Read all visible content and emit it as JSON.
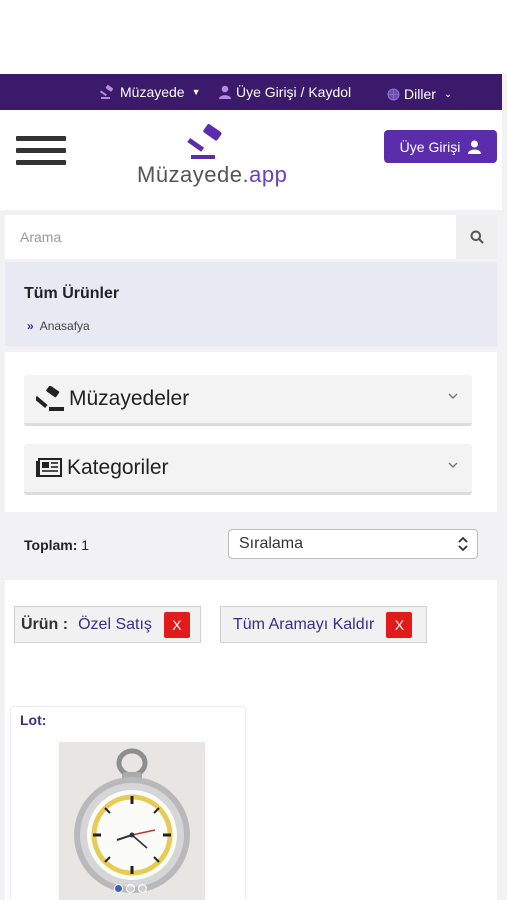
{
  "topbar": {
    "auction_menu": "Müzayede",
    "member_login_register": "Üye Girişi / Kaydol",
    "languages": "Diller"
  },
  "header": {
    "logo_main": "Müzayede",
    "logo_dot": ".",
    "logo_tld": "app",
    "login_button": "Üye Girişi"
  },
  "search": {
    "placeholder": "Arama"
  },
  "breadcrumb": {
    "title": "Tüm Ürünler",
    "home": "Anasafya",
    "separator": "»"
  },
  "filters": {
    "auctions": "Müzayedeler",
    "categories": "Kategoriler"
  },
  "listing": {
    "total_label": "Toplam:",
    "total_value": "1",
    "sort_label": "Sıralama"
  },
  "active_filters": [
    {
      "key": "Ürün :",
      "value": "Özel Satış",
      "remove": "X"
    },
    {
      "value": "Tüm Aramayı Kaldır",
      "remove": "X"
    }
  ],
  "products": [
    {
      "lot_label": "Lot:",
      "image_icon": "pocket-watch",
      "slides": 3,
      "active_slide": 1
    }
  ],
  "colors": {
    "brand_dark": "#3b1a6b",
    "brand": "#5b2dab",
    "remove_red": "#e11a1a"
  }
}
